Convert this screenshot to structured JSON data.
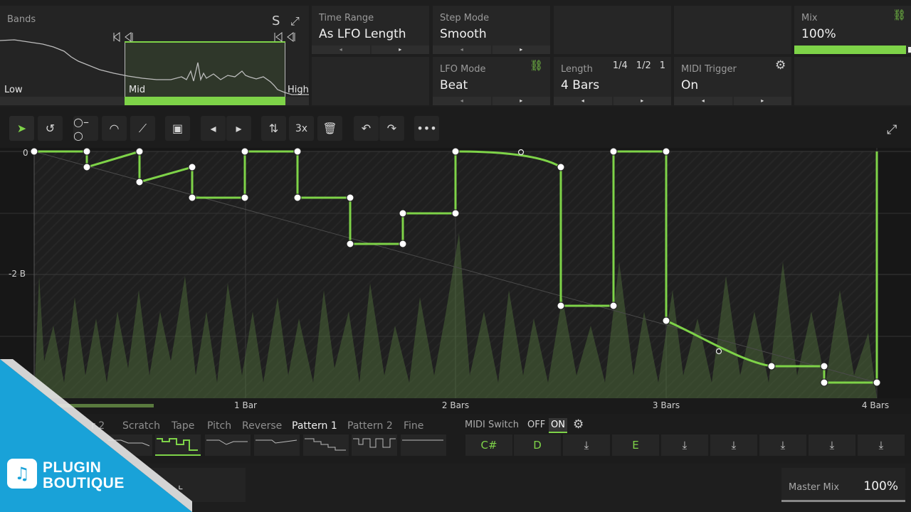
{
  "bands": {
    "label": "Bands",
    "solo_glyph": "S",
    "low_label": "Low",
    "mid_label": "Mid",
    "high_label": "High"
  },
  "params": {
    "time_range": {
      "label": "Time Range",
      "value": "As LFO Length"
    },
    "step_mode": {
      "label": "Step Mode",
      "value": "Smooth"
    },
    "mix": {
      "label": "Mix",
      "value": "100%",
      "level": 1.0
    },
    "lfo_mode": {
      "label": "LFO Mode",
      "value": "Beat"
    },
    "length": {
      "label": "Length",
      "value": "4 Bars",
      "options": [
        "1/4",
        "1/2",
        "1"
      ]
    },
    "midi_trigger": {
      "label": "MIDI Trigger",
      "value": "On"
    }
  },
  "toolbar": {
    "multiply_label": "3x",
    "more_label": "•••"
  },
  "graph": {
    "y_labels": [
      "0",
      "-2 B"
    ],
    "x_labels": [
      "1 Bar",
      "2 Bars",
      "3 Bars",
      "4 Bars"
    ]
  },
  "presets": {
    "tabs": [
      "r 2",
      "Scratch",
      "Tape",
      "Pitch",
      "Reverse",
      "Pattern 1",
      "Pattern 2",
      "Fine"
    ],
    "active_tab": "Pattern 1"
  },
  "midi_switch": {
    "label": "MIDI Switch",
    "off_label": "OFF",
    "on_label": "ON",
    "notes": [
      "C#",
      "D",
      "",
      "E",
      "",
      "",
      "",
      "",
      ""
    ]
  },
  "master_mix": {
    "label": "Master Mix",
    "value": "100%"
  },
  "brand": {
    "line1": "PLUGIN",
    "line2": "BOUTIQUE",
    "color": "#19a2d8"
  },
  "colors": {
    "accent": "#7ed348"
  }
}
